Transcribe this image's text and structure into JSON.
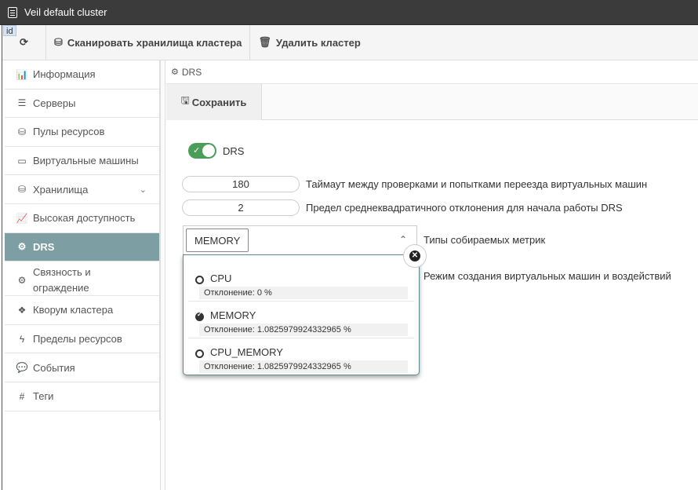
{
  "window": {
    "title": "Veil default cluster",
    "id_badge": "id"
  },
  "toolbar": {
    "scan_label": "Сканировать хранилища кластера",
    "delete_label": "Удалить кластер"
  },
  "sidebar": {
    "items": [
      {
        "label": "Информация",
        "icon": "chart-icon"
      },
      {
        "label": "Серверы",
        "icon": "server-icon"
      },
      {
        "label": "Пулы ресурсов",
        "icon": "database-gear-icon"
      },
      {
        "label": "Виртуальные машины",
        "icon": "monitor-icon"
      },
      {
        "label": "Хранилища",
        "icon": "database-icon"
      },
      {
        "label": "Высокая доступность",
        "icon": "line-chart-icon"
      },
      {
        "label": "DRS",
        "icon": "cogs-icon"
      },
      {
        "label": "Связность и ограждение",
        "icon": "cogs-icon"
      },
      {
        "label": "Кворум кластера",
        "icon": "cubes-icon"
      },
      {
        "label": "Пределы ресурсов",
        "icon": "bolt-icon"
      },
      {
        "label": "События",
        "icon": "comment-icon"
      },
      {
        "label": "Теги",
        "icon": "hashtag-icon"
      }
    ],
    "active_item": "DRS"
  },
  "breadcrumb": {
    "label": "DRS"
  },
  "actions": {
    "save_label": "Сохранить"
  },
  "form": {
    "drs_toggle": {
      "label": "DRS",
      "enabled": true
    },
    "timeout": {
      "value": "180",
      "label": "Таймаут между проверками и попытками переезда виртуальных машин"
    },
    "deviation": {
      "value": "2",
      "label": "Предел среднеквадратичного отклонения для начала работы DRS"
    },
    "metrics": {
      "selected": "MEMORY",
      "label": "Типы собираемых метрик",
      "options": [
        {
          "name": "CPU",
          "desc": "Отклонение: 0 %",
          "checked": false
        },
        {
          "name": "MEMORY",
          "desc": "Отклонение: 1.0825979924332965 %",
          "checked": true
        },
        {
          "name": "CPU_MEMORY",
          "desc": "Отклонение: 1.0825979924332965 %",
          "checked": false
        }
      ]
    },
    "mode_label": "Режим создания виртуальных машин и воздействий"
  },
  "colors": {
    "active_nav": "#7d9ea3",
    "toggle_on": "#4b9e58",
    "dropdown_border": "#5e8c91"
  }
}
